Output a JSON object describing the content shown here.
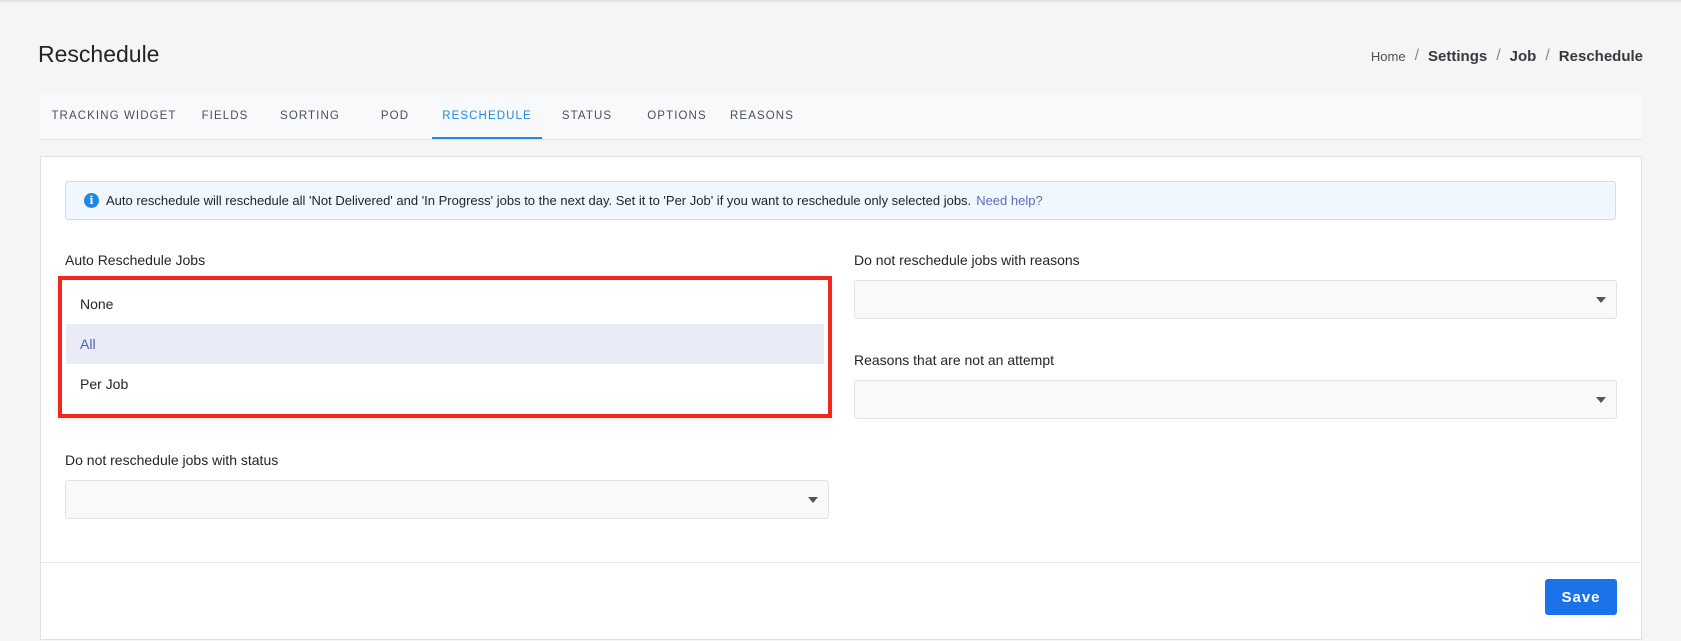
{
  "header": {
    "title": "Reschedule",
    "breadcrumb": [
      "Home",
      "Settings",
      "Job",
      "Reschedule"
    ],
    "breadcrumb_separator": "/"
  },
  "tabs": [
    {
      "label": "TRACKING WIDGET",
      "active": false
    },
    {
      "label": "FIELDS",
      "active": false
    },
    {
      "label": "SORTING",
      "active": false
    },
    {
      "label": "POD",
      "active": false
    },
    {
      "label": "RESCHEDULE",
      "active": true
    },
    {
      "label": "STATUS",
      "active": false
    },
    {
      "label": "OPTIONS",
      "active": false
    },
    {
      "label": "REASONS",
      "active": false
    }
  ],
  "info": {
    "icon": "info-icon",
    "icon_glyph": "i",
    "text": "Auto reschedule will reschedule all 'Not Delivered' and 'In Progress' jobs to the next day. Set it to 'Per Job' if you want to reschedule only selected jobs.",
    "link": "Need help?"
  },
  "form": {
    "auto_reschedule": {
      "label": "Auto Reschedule Jobs",
      "options": [
        "None",
        "All",
        "Per Job"
      ],
      "selected": "All"
    },
    "no_reschedule_reasons": {
      "label": "Do not reschedule jobs with reasons",
      "value": ""
    },
    "not_attempt_reasons": {
      "label": "Reasons that are not an attempt",
      "value": ""
    },
    "no_reschedule_status": {
      "label": "Do not reschedule jobs with status",
      "value": ""
    }
  },
  "actions": {
    "save_label": "Save"
  },
  "colors": {
    "accent": "#1e88e5",
    "save_button": "#1a73e8",
    "highlight_border": "#f0291c",
    "selected_option_bg": "#e9ecf7",
    "link": "#5c6bc0"
  }
}
